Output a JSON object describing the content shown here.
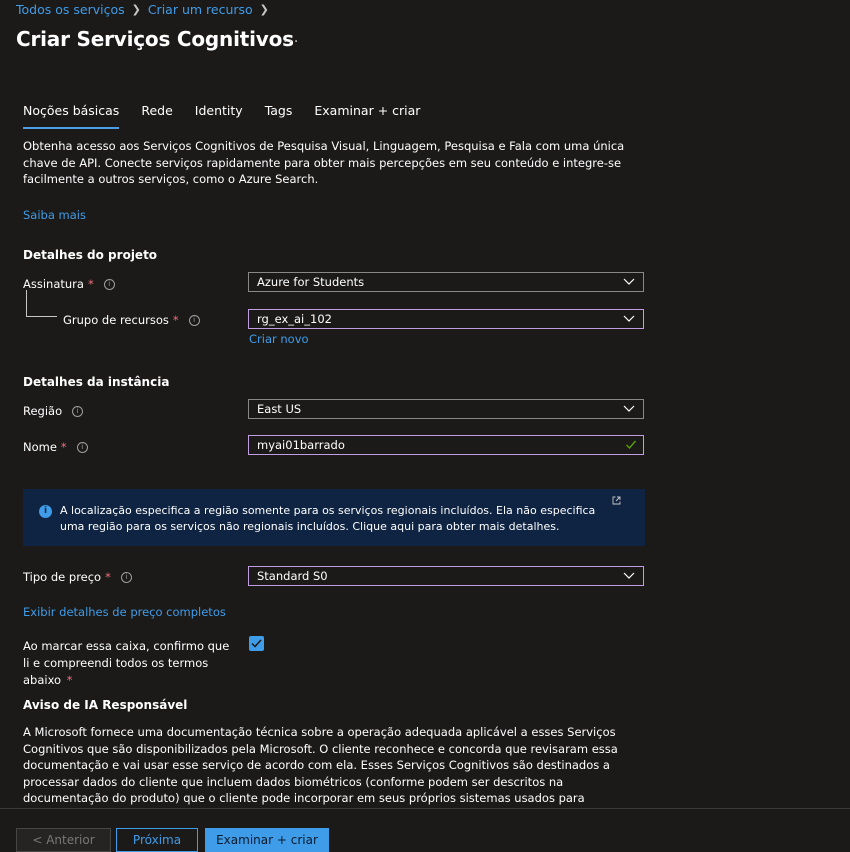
{
  "breadcrumb": {
    "items": [
      "Todos os serviços",
      "Criar um recurso"
    ],
    "separator": ">"
  },
  "page": {
    "title": "Criar Serviços Cognitivos",
    "more": "..."
  },
  "tabs": [
    {
      "label": "Noções básicas",
      "active": true
    },
    {
      "label": "Rede"
    },
    {
      "label": "Identity"
    },
    {
      "label": "Tags"
    },
    {
      "label": "Examinar + criar"
    }
  ],
  "intro": {
    "text": "Obtenha acesso aos Serviços Cognitivos de Pesquisa Visual, Linguagem, Pesquisa e Fala com uma única chave de API. Conecte serviços rapidamente para obter mais percepções em seu conteúdo e integre-se facilmente a outros serviços, como o Azure Search.",
    "learn_more": "Saiba mais"
  },
  "project": {
    "heading": "Detalhes do projeto",
    "subscription": {
      "label": "Assinatura",
      "value": "Azure for Students"
    },
    "resource_group": {
      "label": "Grupo de recursos",
      "value": "rg_ex_ai_102",
      "create_new": "Criar novo"
    }
  },
  "instance": {
    "heading": "Detalhes da instância",
    "region": {
      "label": "Região",
      "value": "East US"
    },
    "name": {
      "label": "Nome",
      "value": "myai01barrado"
    }
  },
  "info_banner": {
    "text": "A localização especifica a região somente para os serviços regionais incluídos. Ela não especifica uma região para os serviços não regionais incluídos. Clique aqui para obter mais detalhes."
  },
  "pricing": {
    "label": "Tipo de preço",
    "value": "Standard S0",
    "details_link": "Exibir detalhes de preço completos"
  },
  "terms": {
    "text": "Ao marcar essa caixa, confirmo que li e compreendi todos os termos abaixo",
    "required_marker": "*",
    "checked": true
  },
  "responsible_ai": {
    "heading": "Aviso de IA Responsável",
    "text": "A Microsoft fornece uma documentação técnica sobre a operação adequada aplicável a esses Serviços Cognitivos que são disponibilizados pela Microsoft. O cliente reconhece e concorda que revisaram essa documentação e vai usar esse serviço de acordo com ela. Esses Serviços Cognitivos são destinados a processar dados do cliente que incluem dados biométricos (conforme podem ser descritos na documentação do produto) que o cliente pode incorporar em seus próprios sistemas usados para identificação pessoal ou outros fins. O cliente reconhece e concorda que é responsável"
  },
  "footer": {
    "prev": "< Anterior",
    "next": "Próxima",
    "review": "Examinar + criar"
  },
  "required_marker": "*",
  "colors": {
    "accent": "#3f9ce8",
    "focus_border": "#c19ee0",
    "required": "#f1707b",
    "info_bg": "#0e2442"
  }
}
